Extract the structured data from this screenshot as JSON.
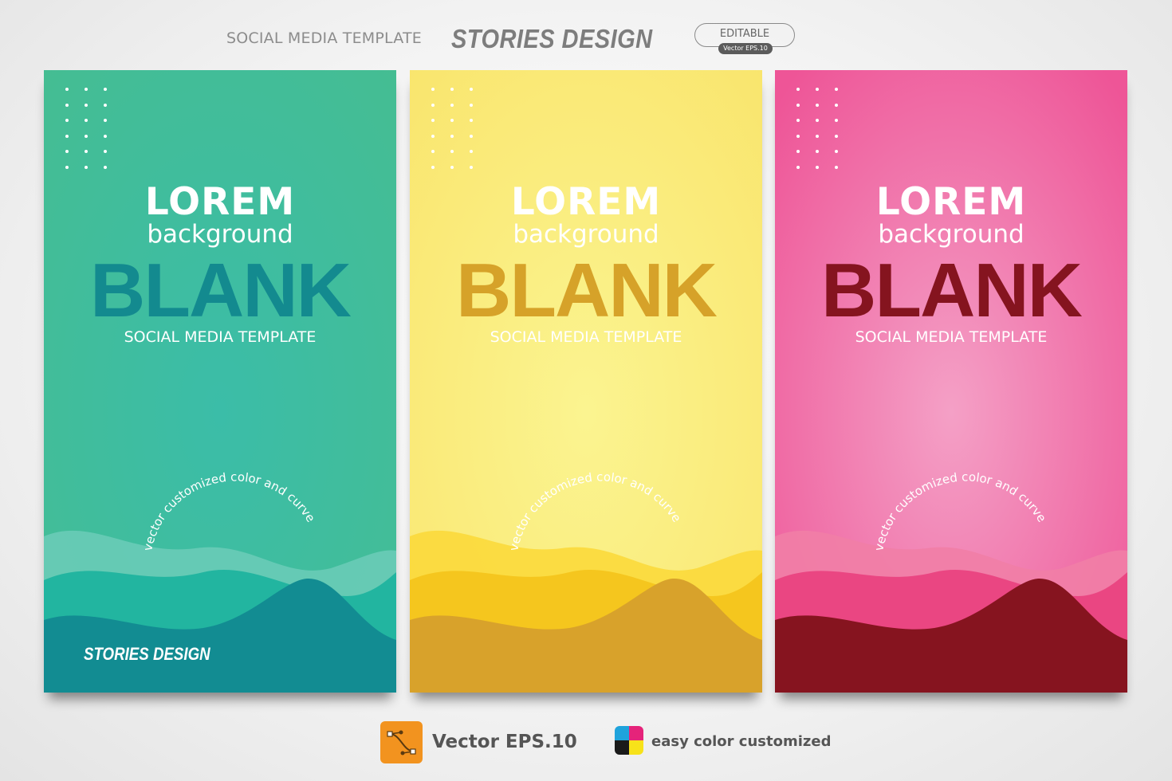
{
  "header": {
    "left_text": "SOCIAL MEDIA TEMPLATE",
    "title": "STORIES DESIGN",
    "editable_label": "EDITABLE",
    "format_badge": "Vector EPS.10"
  },
  "cards": [
    {
      "lorem": "LOREM",
      "background_word": "background",
      "blank": "BLANK",
      "subtitle": "SOCIAL MEDIA TEMPLATE",
      "arc_text": "vector customized color and curve",
      "footer": "STORIES DESIGN",
      "colors": {
        "top": "#42bd95",
        "mid": "#3bbda8",
        "blank": "#138a8f",
        "wave_light": "#6ccdb8",
        "wave_mid": "#22b5a0",
        "wave_dark": "#128c92"
      }
    },
    {
      "lorem": "LOREM",
      "background_word": "background",
      "blank": "BLANK",
      "subtitle": "SOCIAL MEDIA TEMPLATE",
      "arc_text": "vector customized color and curve",
      "colors": {
        "top": "#f9e36b",
        "mid": "#fbf490",
        "blank": "#d6a229",
        "wave_light": "#fbd93b",
        "wave_mid": "#f5c61e",
        "wave_dark": "#d8a22b"
      }
    },
    {
      "lorem": "LOREM",
      "background_word": "background",
      "blank": "BLANK",
      "subtitle": "SOCIAL MEDIA TEMPLATE",
      "arc_text": "vector customized color and curve",
      "colors": {
        "top": "#ee5597",
        "mid": "#f4a0c6",
        "blank": "#85141f",
        "wave_light": "#f17ea6",
        "wave_mid": "#ea4682",
        "wave_dark": "#86141f"
      }
    }
  ],
  "footer": {
    "vector_label": "Vector EPS.10",
    "color_label": "easy color customized",
    "vector_icon": "vector-path-icon",
    "color_icon": "cmyk-color-icon"
  }
}
